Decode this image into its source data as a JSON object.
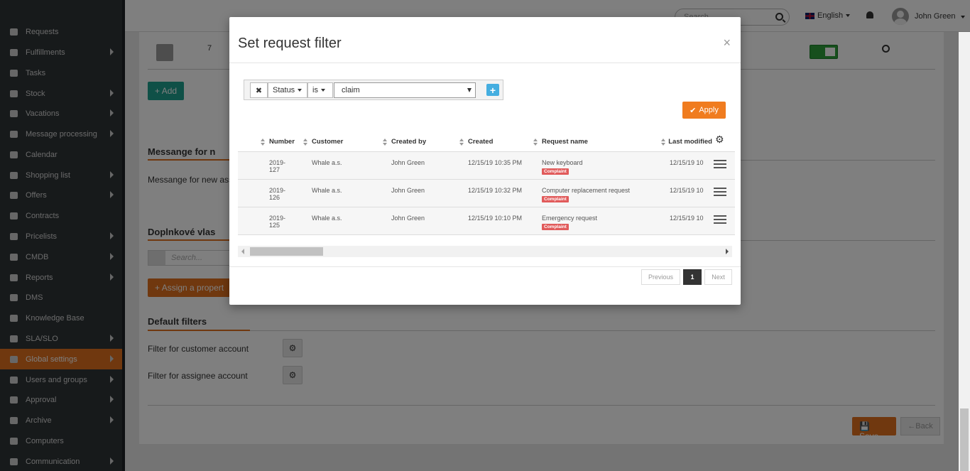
{
  "sidebar": {
    "items": [
      {
        "label": "Requests",
        "icon": "gear-icon",
        "chevron": false
      },
      {
        "label": "Fulfillments",
        "icon": "box-icon",
        "chevron": true
      },
      {
        "label": "Tasks",
        "icon": "list-icon",
        "chevron": false
      },
      {
        "label": "Stock",
        "icon": "archive-icon",
        "chevron": true
      },
      {
        "label": "Vacations",
        "icon": "plane-icon",
        "chevron": true
      },
      {
        "label": "Message processing",
        "icon": "envelope-icon",
        "chevron": true
      },
      {
        "label": "Calendar",
        "icon": "calendar-icon",
        "chevron": false
      },
      {
        "label": "Shopping list",
        "icon": "cart-icon",
        "chevron": true
      },
      {
        "label": "Offers",
        "icon": "gift-icon",
        "chevron": true
      },
      {
        "label": "Contracts",
        "icon": "file-icon",
        "chevron": false
      },
      {
        "label": "Pricelists",
        "icon": "file-text-icon",
        "chevron": true
      },
      {
        "label": "CMDB",
        "icon": "folder-icon",
        "chevron": true
      },
      {
        "label": "Reports",
        "icon": "folder-open-icon",
        "chevron": true
      },
      {
        "label": "DMS",
        "icon": "database-icon",
        "chevron": false
      },
      {
        "label": "Knowledge Base",
        "icon": "book-icon",
        "chevron": false
      },
      {
        "label": "SLA/SLO",
        "icon": "gavel-icon",
        "chevron": true
      },
      {
        "label": "Global settings",
        "icon": "cogs-icon",
        "chevron": true
      },
      {
        "label": "Users and groups",
        "icon": "users-icon",
        "chevron": true
      },
      {
        "label": "Approval",
        "icon": "pen-icon",
        "chevron": true
      },
      {
        "label": "Archive",
        "icon": "archive-icon",
        "chevron": true
      },
      {
        "label": "Computers",
        "icon": "laptop-icon",
        "chevron": false
      },
      {
        "label": "Communication",
        "icon": "exchange-icon",
        "chevron": true
      }
    ],
    "active": "Global settings",
    "active_color": "#e0711f"
  },
  "topbar": {
    "search_placeholder": "Search...",
    "language": "English",
    "user_name": "John Green"
  },
  "page": {
    "row_number": "7",
    "add_label": "Add",
    "section_message": "Messange for n",
    "message_text": "Messange for new ass",
    "section_extra": "Doplnkové vlas",
    "search_placeholder": "Search...",
    "assign_label": "Assign a propert",
    "section_default_filters": "Default filters",
    "filter_customer_label": "Filter for customer account",
    "filter_assignee_label": "Filter for assignee account",
    "save_label": "Save",
    "back_label": "Back"
  },
  "modal": {
    "title": "Set request filter",
    "close": "×",
    "filter": {
      "remove": "✖",
      "field": "Status",
      "operator": "is",
      "value": "claim",
      "add": "+"
    },
    "apply_label": "Apply",
    "columns": [
      "Number",
      "Customer",
      "Created by",
      "Created",
      "Request name",
      "Last modified"
    ],
    "rows": [
      {
        "number_line1": "2019-",
        "number_line2": "127",
        "customer": "Whale a.s.",
        "created_by": "John Green",
        "created": "12/15/19 10:35 PM",
        "request_name": "New keyboard",
        "badge": "Complaint",
        "last_modified": "12/15/19 10"
      },
      {
        "number_line1": "2019-",
        "number_line2": "126",
        "customer": "Whale a.s.",
        "created_by": "John Green",
        "created": "12/15/19 10:32 PM",
        "request_name": "Computer replacement request",
        "badge": "Complaint",
        "last_modified": "12/15/19 10"
      },
      {
        "number_line1": "2019-",
        "number_line2": "125",
        "customer": "Whale a.s.",
        "created_by": "John Green",
        "created": "12/15/19 10:10 PM",
        "request_name": "Emergency request",
        "badge": "Complaint",
        "last_modified": "12/15/19 10"
      }
    ],
    "pagination": {
      "previous": "Previous",
      "current": "1",
      "next": "Next"
    }
  }
}
